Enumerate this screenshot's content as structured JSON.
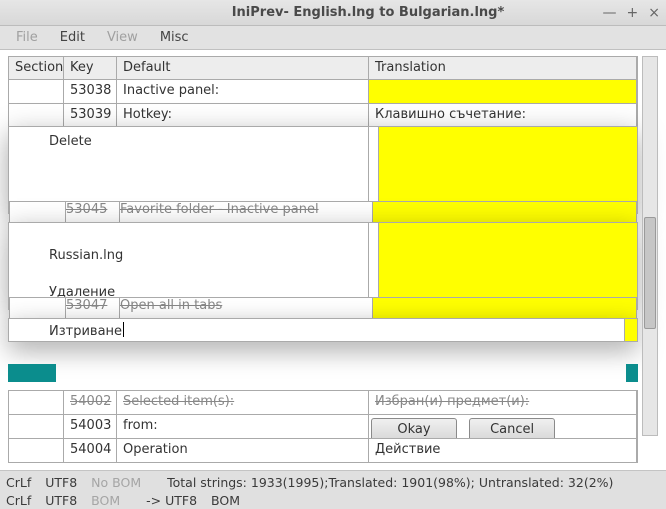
{
  "window": {
    "title": "IniPrev- English.lng to Bulgarian.lng*"
  },
  "menu": {
    "file": "File",
    "edit": "Edit",
    "view": "View",
    "misc": "Misc"
  },
  "columns": {
    "section": "Section",
    "key": "Key",
    "default": "Default",
    "translation": "Translation"
  },
  "rows_top": [
    {
      "section": "",
      "key": "53038",
      "default": "Inactive panel:",
      "translation": "",
      "hl": true
    },
    {
      "section": "",
      "key": "53039",
      "default": "Hotkey:",
      "translation": "Клавишно съчетание:",
      "hl": false
    }
  ],
  "overlay1": {
    "left_text": "Delete",
    "strip_key": "53045",
    "strip_default": "Favorite folder - Inactive panel"
  },
  "overlay2": {
    "left_line1": "Russian.lng",
    "left_line2": "Удаление",
    "strip_key": "53047",
    "strip_default": "Open all in tabs"
  },
  "edit": {
    "value": "Изтриване"
  },
  "rows_bottom": [
    {
      "section": "",
      "key": "54002",
      "default": "Selected item(s):",
      "translation": "Избран(и) предмет(и):"
    },
    {
      "section": "",
      "key": "54003",
      "default": "from:",
      "translation": ""
    },
    {
      "section": "",
      "key": "54004",
      "default": "Operation",
      "translation": "Действие"
    }
  ],
  "buttons": {
    "okay": "Okay",
    "cancel": "Cancel"
  },
  "status": {
    "line1": {
      "eol": "CrLf",
      "enc": "UTF8",
      "bom": "No BOM",
      "summary": "Total strings: 1933(1995);Translated: 1901(98%); Untranslated: 32(2%)"
    },
    "line2": {
      "eol": "CrLf",
      "enc": "UTF8",
      "bom": "BOM",
      "arrow": "-> UTF8",
      "bom2": "BOM"
    }
  }
}
